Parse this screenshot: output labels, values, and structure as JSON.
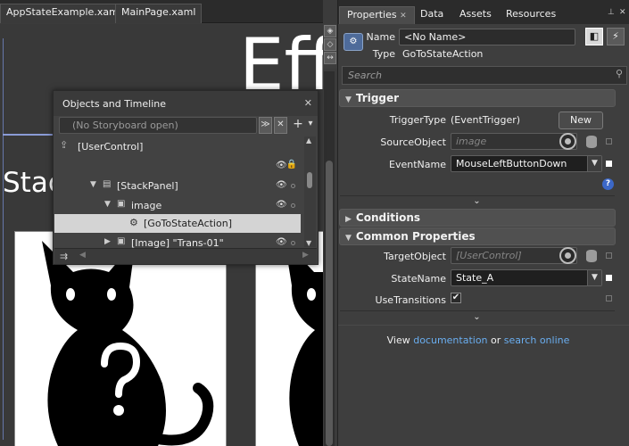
{
  "doc_tabs": [
    "AppStateExample.xaml",
    "MainPage.xaml"
  ],
  "canvas": {
    "big_text": "Eff",
    "stack_text": "Stac"
  },
  "objects_panel": {
    "title": "Objects and Timeline",
    "storyboard": "(No Storyboard open)",
    "rows": [
      {
        "label": "[UserControl]"
      },
      {
        "label": "[StackPanel]"
      },
      {
        "label": "image"
      },
      {
        "label": "[GoToStateAction]"
      },
      {
        "label": "[Image] \"Trans-01\""
      }
    ]
  },
  "properties": {
    "tabs": [
      "Properties",
      "Data",
      "Assets",
      "Resources"
    ],
    "name_label": "Name",
    "name_value": "<No Name>",
    "type_label": "Type",
    "type_value": "GoToStateAction",
    "search_placeholder": "Search",
    "trigger": {
      "header": "Trigger",
      "triggertype_label": "TriggerType",
      "triggertype_value": "(EventTrigger)",
      "new_button": "New",
      "sourceobject_label": "SourceObject",
      "sourceobject_value": "image",
      "eventname_label": "EventName",
      "eventname_value": "MouseLeftButtonDown"
    },
    "conditions_header": "Conditions",
    "common": {
      "header": "Common Properties",
      "targetobject_label": "TargetObject",
      "targetobject_value": "[UserControl]",
      "statename_label": "StateName",
      "statename_value": "State_A",
      "usetransitions_label": "UseTransitions"
    },
    "footer": {
      "prefix": "View ",
      "link1": "documentation",
      "middle": " or ",
      "link2": "search online"
    }
  }
}
